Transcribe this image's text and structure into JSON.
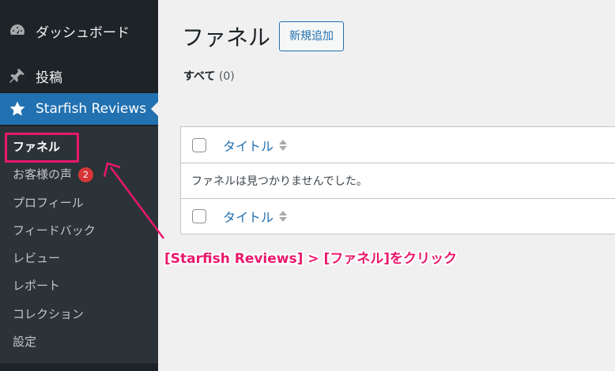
{
  "sidebar": {
    "menu": [
      {
        "label": "ダッシュボード",
        "icon": "dashboard-icon"
      },
      {
        "label": "投稿",
        "icon": "pin-icon"
      },
      {
        "label": "Starfish Reviews",
        "icon": "star-icon",
        "active": true
      }
    ],
    "submenu": [
      {
        "label": "ファネル",
        "current": true
      },
      {
        "label": "お客様の声",
        "badge": "2"
      },
      {
        "label": "プロフィール"
      },
      {
        "label": "フィードバック"
      },
      {
        "label": "レビュー"
      },
      {
        "label": "レポート"
      },
      {
        "label": "コレクション"
      },
      {
        "label": "設定"
      }
    ]
  },
  "main": {
    "title": "ファネル",
    "add_new": "新規追加",
    "filter": {
      "label": "すべて",
      "count": "(0)"
    },
    "table": {
      "column_title": "タイトル",
      "empty_message": "ファネルは見つかりませんでした。"
    }
  },
  "annotation": {
    "text": "[Starfish Reviews] > [ファネル]をクリック"
  },
  "colors": {
    "sidebar_bg": "#1d2327",
    "submenu_bg": "#2c3338",
    "active_bg": "#2271b1",
    "accent_link": "#2271b1",
    "annotation": "#e8186b",
    "badge": "#d63638"
  }
}
